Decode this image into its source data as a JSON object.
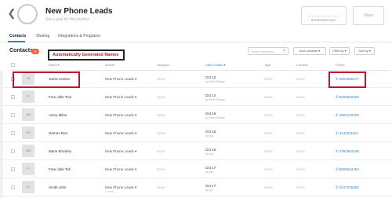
{
  "header": {
    "back_icon": "chevron-left-icon",
    "title": "New Phone Leads",
    "subtitle": "Set a goal for this bucket",
    "refreshed_label": "REFRESHED DAILY",
    "share_label": "Share"
  },
  "tabs": [
    {
      "label": "Contacts",
      "active": true
    },
    {
      "label": "Sharing",
      "active": false
    },
    {
      "label": "Integrations & Programs",
      "active": false
    }
  ],
  "toolbar": {
    "title": "Contacts",
    "count": "10",
    "search_placeholder": "Search contacts...",
    "add_contacts": "Add contacts ▾",
    "filter_by": "Filter by ▾",
    "sort_by": "Sort by ▾"
  },
  "annotation": {
    "text": "Automatically Generated Names",
    "color": "#c0152b"
  },
  "columns": {
    "name": "Name ▾",
    "bucket": "Bucket",
    "assigned": "Assigned",
    "last_contact": "Last Contact ▾",
    "tags": "Tags",
    "location": "Location",
    "phone": "Phone"
  },
  "rows": [
    {
      "initials": "JK",
      "name": "Jamie Keeton",
      "bucket": "New Phone Leads ▾",
      "bucket_sub": "",
      "assigned": "None",
      "date": "Oct 12",
      "by": "by Keith Sharpe",
      "tags": "None",
      "location": "None",
      "phone": "4802365477"
    },
    {
      "initials": "FT",
      "name": "Free calle Tool",
      "bucket": "New Phone Leads ▾",
      "bucket_sub": "",
      "assigned": "None",
      "date": "Oct 14",
      "by": "by Keith Sharpe",
      "tags": "None",
      "location": "None",
      "phone": "8008662453"
    },
    {
      "initials": "AM",
      "name": "Avery Milne",
      "bucket": "New Phone Leads ▾",
      "bucket_sub": "",
      "assigned": "None",
      "date": "Oct 16",
      "by": "by Keith Sharpe",
      "tags": "None",
      "location": "None",
      "phone": "4802130720"
    },
    {
      "initials": "GR",
      "name": "Games Riot",
      "bucket": "New Phone Leads ▾",
      "bucket_sub": "",
      "assigned": "None",
      "date": "Oct 16",
      "by": "by you",
      "tags": "None",
      "location": "None",
      "phone": "4242211112"
    },
    {
      "initials": "MB",
      "name": "Marie Brumley",
      "bucket": "New Phone Leads ▾",
      "bucket_sub": "",
      "assigned": "None",
      "date": "Oct 16",
      "by": "by you",
      "tags": "None",
      "location": "None",
      "phone": "4792562248"
    },
    {
      "initials": "FT",
      "name": "Free calle Toll",
      "bucket": "New Phone Leads ▾",
      "bucket_sub": "",
      "assigned": "None",
      "date": "Oct 17",
      "by": "by you",
      "tags": "None",
      "location": "None",
      "phone": "8008662453"
    },
    {
      "initials": "SJ",
      "name": "Smith John",
      "bucket": "New Phone Leads ▾",
      "bucket_sub": "1 more",
      "assigned": "None",
      "date": "Oct 17",
      "by": "by you",
      "tags": "None",
      "location": "None",
      "phone": "4247045550"
    }
  ],
  "colors": {
    "accent": "#3a82c4",
    "badge": "#e8643a",
    "highlight": "#c0152b"
  }
}
